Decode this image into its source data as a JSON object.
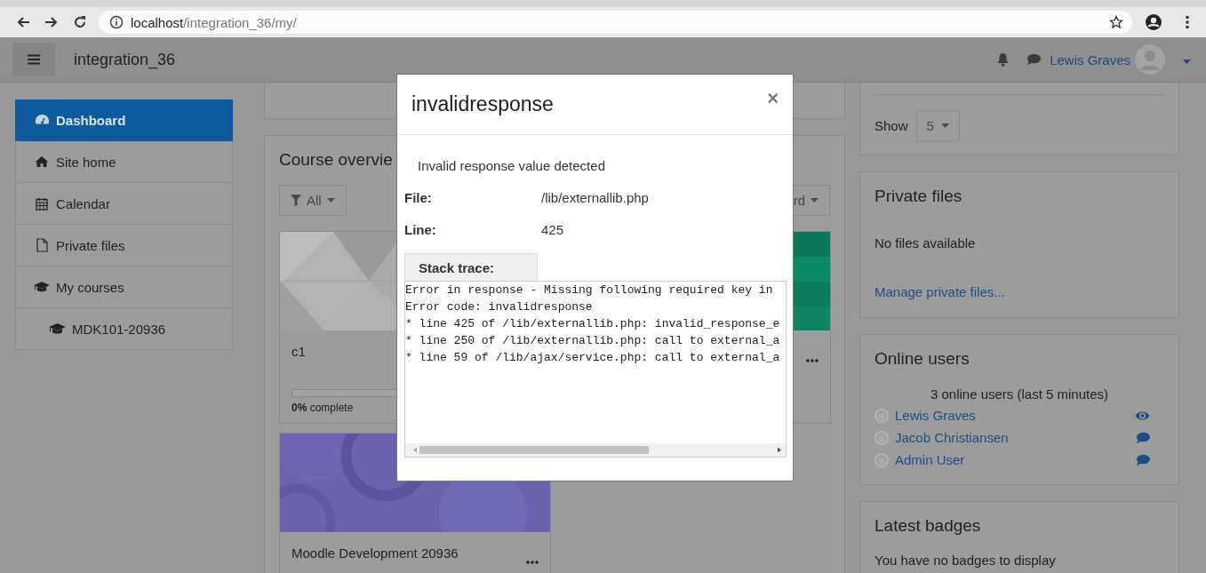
{
  "browser": {
    "address": {
      "host": "localhost",
      "path": "/integration_36/my/"
    }
  },
  "navbar": {
    "site_name": "integration_36",
    "user_name": "Lewis Graves"
  },
  "sidebar": {
    "items": [
      {
        "label": "Dashboard",
        "selected": true
      },
      {
        "label": "Site home",
        "selected": false
      },
      {
        "label": "Calendar",
        "selected": false
      },
      {
        "label": "Private files",
        "selected": false
      },
      {
        "label": "My courses",
        "selected": false,
        "children": [
          {
            "label": "MDK101-20936",
            "selected": false
          }
        ]
      }
    ]
  },
  "course_overview": {
    "title": "Course overvie",
    "filter": {
      "label": "All"
    },
    "sort": {
      "label": "rd"
    },
    "courses": [
      {
        "kind": "pattern",
        "name": "c1",
        "level": 0,
        "progress": "**0%** complete"
      },
      {
        "kind": "green"
      },
      {
        "kind": "circles",
        "name": "Moodle Development 20936"
      }
    ]
  },
  "blocks": {
    "show": {
      "label": "Show",
      "value": "5"
    },
    "private_files": {
      "title": "Private files",
      "message": "No files available",
      "link": "Manage private files..."
    },
    "online_users": {
      "title": "Online users",
      "summary": "3 online users (last 5 minutes)",
      "users": [
        {
          "name": "Lewis Graves",
          "kind": "self"
        },
        {
          "name": "Jacob Christiansen",
          "kind": "other"
        },
        {
          "name": "Admin User",
          "kind": "other"
        }
      ]
    },
    "latest_badges": {
      "title": "Latest badges",
      "message": "You have no badges to display"
    }
  },
  "modal": {
    "title": "invalidresponse",
    "close": "×",
    "message": "Invalid response value detected",
    "fields": [
      {
        "label": "File:",
        "value": "/lib/externallib.php"
      },
      {
        "label": "Line:",
        "value": "425"
      }
    ],
    "stack_trace": {
      "label": "Stack trace:",
      "lines": [
        "Error in response - Missing following required key in",
        "Error code: invalidresponse",
        "* line 425 of /lib/externallib.php: invalid_response_e",
        "* line 250 of /lib/externallib.php: call to external_a",
        "* line 59 of /lib/ajax/service.php: call to external_a"
      ]
    }
  }
}
